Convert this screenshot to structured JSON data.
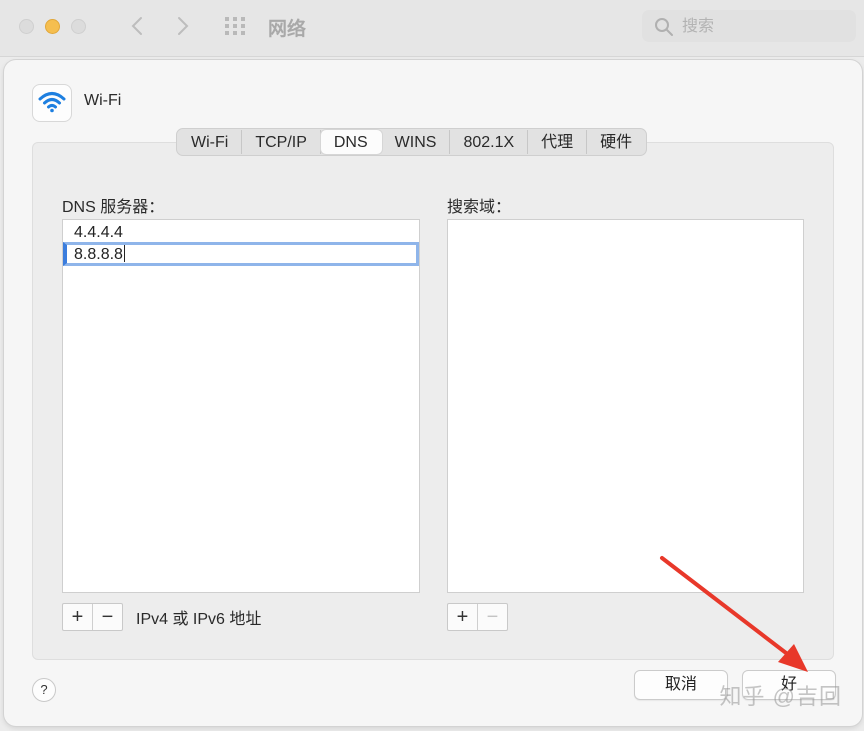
{
  "window": {
    "title": "网络"
  },
  "search": {
    "placeholder": "搜索"
  },
  "interface": {
    "name": "Wi-Fi",
    "icon": "wifi-icon"
  },
  "tabs": [
    {
      "label": "Wi-Fi",
      "active": false
    },
    {
      "label": "TCP/IP",
      "active": false
    },
    {
      "label": "DNS",
      "active": true
    },
    {
      "label": "WINS",
      "active": false
    },
    {
      "label": "802.1X",
      "active": false
    },
    {
      "label": "代理",
      "active": false
    },
    {
      "label": "硬件",
      "active": false
    }
  ],
  "dns": {
    "label": "DNS 服务器：",
    "servers": [
      "4.4.4.4",
      "8.8.8.8"
    ],
    "editing_index": 1,
    "hint": "IPv4 或 IPv6 地址"
  },
  "search_domains": {
    "label": "搜索域：",
    "items": []
  },
  "buttons": {
    "add": "+",
    "remove": "−",
    "cancel": "取消",
    "ok": "好",
    "help": "?"
  },
  "watermark": "知乎 @吉回",
  "colors": {
    "accent": "#3b7ddd",
    "annotation_arrow": "#e8382a",
    "minimize_light": "#f5be4f"
  }
}
